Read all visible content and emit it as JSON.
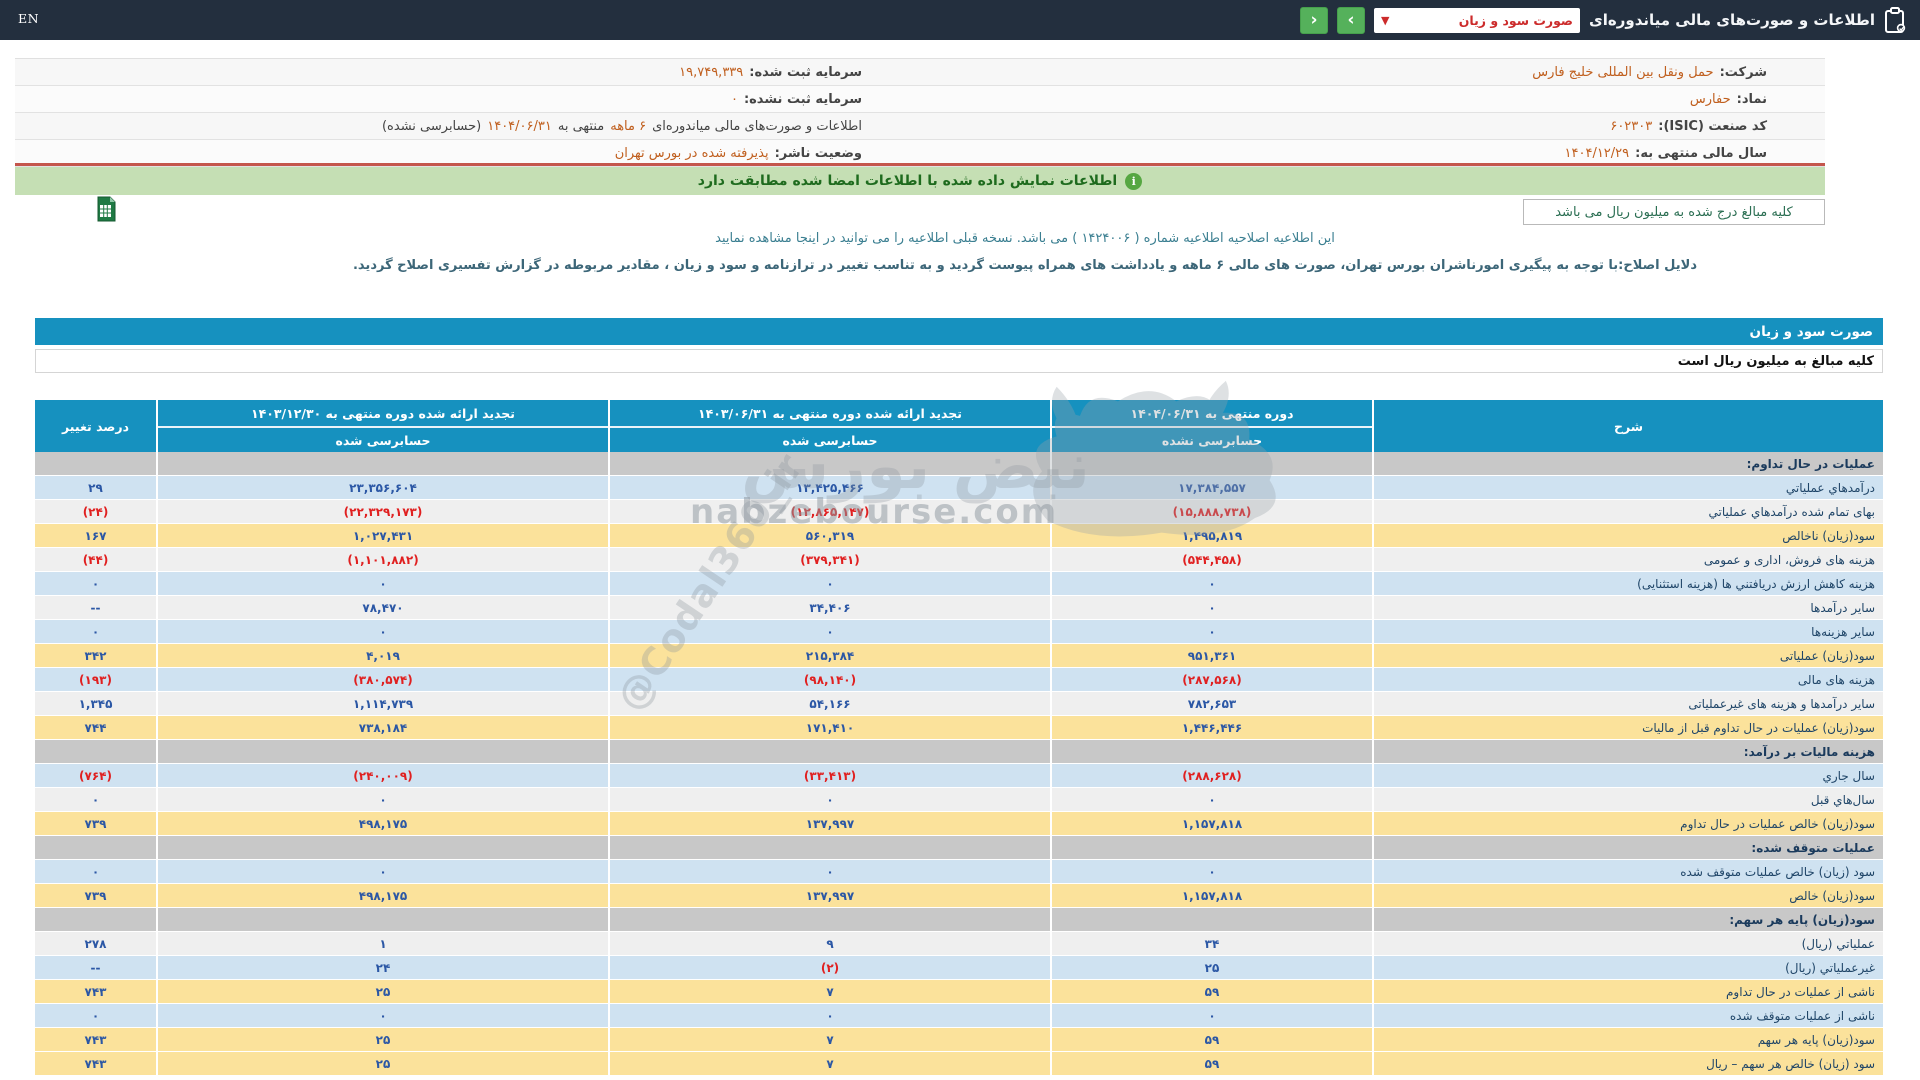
{
  "navbar": {
    "en_label": "EN",
    "title": "اطلاعات و صورت‌های مالی میاندوره‌ای",
    "dropdown_value": "صورت سود و زیان",
    "prev_button": "‹",
    "next_button": "›"
  },
  "company_info": {
    "rows": [
      {
        "right": {
          "label": "شرکت:",
          "value": "حمل ونقل بین المللی خلیج فارس"
        },
        "left": {
          "label": "سرمایه ثبت شده:",
          "value": "۱۹,۷۴۹,۳۳۹"
        }
      },
      {
        "right": {
          "label": "نماد:",
          "value": "حفارس"
        },
        "left": {
          "label": "سرمایه ثبت نشده:",
          "value": "۰"
        }
      },
      {
        "right": {
          "label": "کد صنعت (ISIC):",
          "value": "۶۰۲۳۰۳"
        },
        "left": {
          "parts": [
            {
              "t": "اطلاعات و صورت‌های مالی میاندوره‌ای ",
              "c": "dark"
            },
            {
              "t": "۶ ماهه",
              "c": "orange"
            },
            {
              "t": " منتهی به ",
              "c": "dark"
            },
            {
              "t": "۱۴۰۴/۰۶/۳۱",
              "c": "orange"
            },
            {
              "t": "(حسابرسی نشده)",
              "c": "dark"
            }
          ]
        }
      },
      {
        "right": {
          "label": "سال مالی منتهی به:",
          "value": "۱۴۰۴/۱۲/۲۹"
        },
        "left": {
          "label": "وضعیت ناشر:",
          "value": "پذیرفته شده در بورس تهران"
        }
      }
    ]
  },
  "signed_banner": "اطلاعات نمایش داده شده با اطلاعات امضا شده مطابقت دارد",
  "unit_note_box": "کلیه مبالغ درج شده به میلیون ریال می باشد",
  "amendment": {
    "line1_pre": "این اطلاعیه اصلاحیه اطلاعیه شماره ( ۱۴۲۴۰۰۶ ) می باشد. نسخه قبلی اطلاعیه را می توانید در ",
    "line1_link": "اینجا",
    "line1_post": " مشاهده نمایید",
    "line2": "دلایل اصلاح:با توجه به پیگیری امورناشران بورس تهران، صورت های مالی ۶ ماهه و یادداشت های همراه پیوست گردید و به تناسب تغییر در ترازنامه و سود و زیان ، مقادیر مربوطه در گزارش تفسیری اصلاح گردید."
  },
  "section_bar": "صورت سود و زیان",
  "unit_note_table": "کلیه مبالغ به میلیون ریال است",
  "table": {
    "headers": {
      "sharh": "شرح",
      "current": {
        "period": "دوره منتهی به ۱۴۰۴/۰۶/۳۱",
        "audit": "حسابرسی نشده"
      },
      "restated_6m": {
        "period": "تجدید ارائه شده دوره منتهی به ۱۴۰۳/۰۶/۳۱",
        "audit": "حسابرسی شده"
      },
      "restated_annual": {
        "period": "تجدید ارائه شده دوره منتهی به ۱۴۰۳/۱۲/۳۰",
        "audit": "حسابرسی شده"
      },
      "change": "درصد تغییر"
    },
    "rows": [
      {
        "t": "section",
        "bg": "gray",
        "label": "عملیات در حال تداوم:",
        "v1": "",
        "v2": "",
        "v3": "",
        "chg": ""
      },
      {
        "t": "data",
        "bg": "blue",
        "label": "درآمدهاي عملياتي",
        "v1": "۱۷,۳۸۴,۵۵۷",
        "v2": "۱۳,۴۲۵,۴۶۶",
        "v3": "۲۳,۳۵۶,۶۰۴",
        "chg": "۲۹"
      },
      {
        "t": "data",
        "bg": "white",
        "label": "بهای تمام شده درآمدهاي عملياتي",
        "v1": "(۱۵,۸۸۸,۷۳۸)",
        "v2": "(۱۲,۸۶۵,۱۴۷)",
        "v3": "(۲۲,۳۲۹,۱۷۳)",
        "chg": "(۲۴)"
      },
      {
        "t": "data",
        "bg": "yellow",
        "label": "سود(زیان) ناخالص",
        "v1": "۱,۴۹۵,۸۱۹",
        "v2": "۵۶۰,۳۱۹",
        "v3": "۱,۰۲۷,۴۳۱",
        "chg": "۱۶۷"
      },
      {
        "t": "data",
        "bg": "white",
        "label": "هزینه های فروش، اداری و عمومی",
        "v1": "(۵۴۴,۴۵۸)",
        "v2": "(۳۷۹,۳۴۱)",
        "v3": "(۱,۱۰۱,۸۸۲)",
        "chg": "(۴۴)"
      },
      {
        "t": "data",
        "bg": "blue",
        "label": "هزینه کاهش ارزش دریافتني ها (هزینه استثنایی)",
        "v1": "۰",
        "v2": "۰",
        "v3": "۰",
        "chg": "۰"
      },
      {
        "t": "data",
        "bg": "white",
        "label": "سایر درآمدها",
        "v1": "۰",
        "v2": "۳۴,۴۰۶",
        "v3": "۷۸,۴۷۰",
        "chg": "--"
      },
      {
        "t": "data",
        "bg": "blue",
        "label": "سایر هزینه‌ها",
        "v1": "۰",
        "v2": "۰",
        "v3": "۰",
        "chg": "۰"
      },
      {
        "t": "data",
        "bg": "yellow",
        "label": "سود(زیان) عملياتی",
        "v1": "۹۵۱,۳۶۱",
        "v2": "۲۱۵,۳۸۴",
        "v3": "۴,۰۱۹",
        "chg": "۳۴۲"
      },
      {
        "t": "data",
        "bg": "blue",
        "label": "هزینه های مالی",
        "v1": "(۲۸۷,۵۶۸)",
        "v2": "(۹۸,۱۴۰)",
        "v3": "(۳۸۰,۵۷۴)",
        "chg": "(۱۹۳)"
      },
      {
        "t": "data",
        "bg": "white",
        "label": "سایر درآمدها و هزینه های غیرعملیاتی",
        "v1": "۷۸۲,۶۵۳",
        "v2": "۵۴,۱۶۶",
        "v3": "۱,۱۱۴,۷۳۹",
        "chg": "۱,۳۴۵"
      },
      {
        "t": "data",
        "bg": "yellow",
        "label": "سود(زیان) عملیات در حال تداوم قبل از مالیات",
        "v1": "۱,۴۴۶,۴۴۶",
        "v2": "۱۷۱,۴۱۰",
        "v3": "۷۳۸,۱۸۴",
        "chg": "۷۴۴"
      },
      {
        "t": "section",
        "bg": "gray",
        "label": "هزینه مالیات بر درآمد:",
        "v1": "",
        "v2": "",
        "v3": "",
        "chg": ""
      },
      {
        "t": "data",
        "bg": "blue",
        "label": "سال جاري",
        "v1": "(۲۸۸,۶۲۸)",
        "v2": "(۳۳,۴۱۳)",
        "v3": "(۲۴۰,۰۰۹)",
        "chg": "(۷۶۴)"
      },
      {
        "t": "data",
        "bg": "white",
        "label": "سال‌هاي قبل",
        "v1": "۰",
        "v2": "۰",
        "v3": "۰",
        "chg": "۰"
      },
      {
        "t": "data",
        "bg": "yellow",
        "label": "سود(زیان) خالص عملیات در حال تداوم",
        "v1": "۱,۱۵۷,۸۱۸",
        "v2": "۱۳۷,۹۹۷",
        "v3": "۴۹۸,۱۷۵",
        "chg": "۷۳۹"
      },
      {
        "t": "section",
        "bg": "gray",
        "label": "عملیات متوقف شده:",
        "v1": "",
        "v2": "",
        "v3": "",
        "chg": ""
      },
      {
        "t": "data",
        "bg": "blue",
        "label": "سود (زیان) خالص عملیات متوقف شده",
        "v1": "۰",
        "v2": "۰",
        "v3": "۰",
        "chg": "۰"
      },
      {
        "t": "data",
        "bg": "yellow",
        "label": "سود(زیان) خالص",
        "v1": "۱,۱۵۷,۸۱۸",
        "v2": "۱۳۷,۹۹۷",
        "v3": "۴۹۸,۱۷۵",
        "chg": "۷۳۹"
      },
      {
        "t": "section",
        "bg": "gray",
        "label": "سود(زیان) پایه هر سهم:",
        "v1": "",
        "v2": "",
        "v3": "",
        "chg": ""
      },
      {
        "t": "data",
        "bg": "white",
        "label": "عملیاتي (ریال)",
        "v1": "۳۴",
        "v2": "۹",
        "v3": "۱",
        "chg": "۲۷۸"
      },
      {
        "t": "data",
        "bg": "blue",
        "label": "غیرعملیاتي (ریال)",
        "v1": "۲۵",
        "v2": "(۲)",
        "v3": "۲۴",
        "chg": "--"
      },
      {
        "t": "data",
        "bg": "yellow",
        "label": "ناشی از عملیات در حال تداوم",
        "v1": "۵۹",
        "v2": "۷",
        "v3": "۲۵",
        "chg": "۷۴۳"
      },
      {
        "t": "data",
        "bg": "blue",
        "label": "ناشی از عملیات متوقف شده",
        "v1": "۰",
        "v2": "۰",
        "v3": "۰",
        "chg": "۰"
      },
      {
        "t": "data",
        "bg": "yellow",
        "label": "سود(زیان) پایه هر سهم",
        "v1": "۵۹",
        "v2": "۷",
        "v3": "۲۵",
        "chg": "۷۴۳"
      },
      {
        "t": "data",
        "bg": "yellow",
        "label": "سود (زیان) خالص هر سهم – ریال",
        "v1": "۵۹",
        "v2": "۷",
        "v3": "۲۵",
        "chg": "۷۴۳"
      }
    ]
  },
  "watermarks": {
    "site": "nabzebourse.com",
    "fa_logo": "نبض بورس",
    "stamp": "@Codal360_ir"
  },
  "colors": {
    "accent_cyan": "#1691bf",
    "navbar_bg": "#232f3e",
    "positive_number": "#2b57a5",
    "negative_number": "#e02020",
    "orange_value": "#c05f1e",
    "yellow_row": "#fbe29b",
    "blue_row": "#cfe2f1",
    "gray_row": "#c8c8c8",
    "banner_green": "#c5dfb4"
  }
}
